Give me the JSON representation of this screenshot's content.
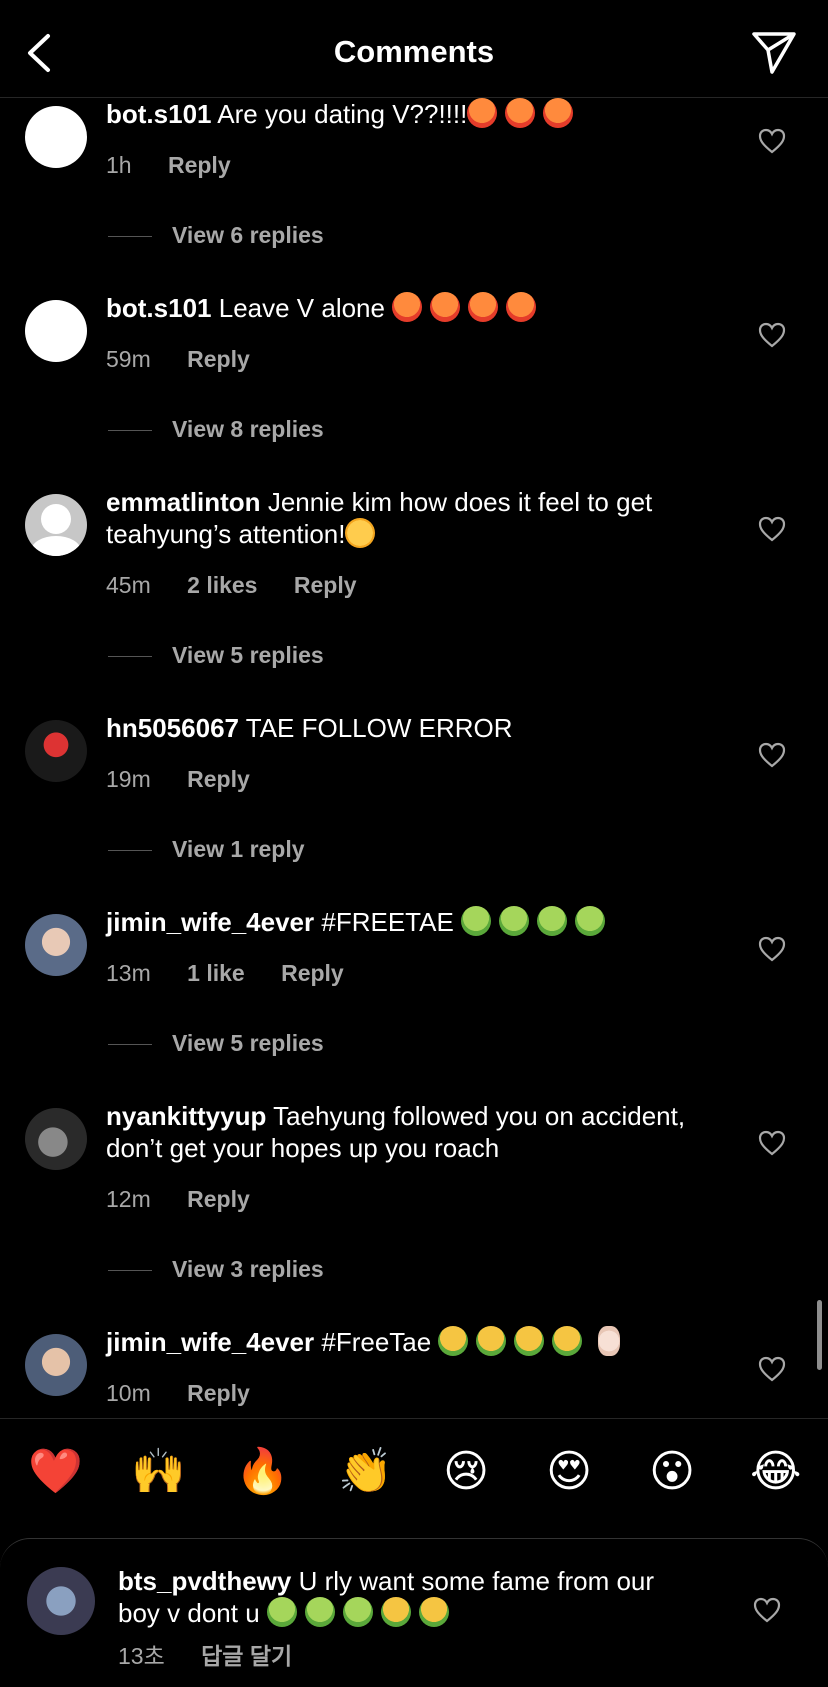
{
  "header": {
    "title": "Comments"
  },
  "comments": [
    {
      "username": "bot.s101",
      "text": "Are you dating V??!!!!",
      "time": "1h",
      "likes": "",
      "reply": "Reply",
      "view_replies": "View 6 replies"
    },
    {
      "username": "bot.s101",
      "text": "Leave V alone",
      "time": "59m",
      "likes": "",
      "reply": "Reply",
      "view_replies": "View 8 replies"
    },
    {
      "username": "emmatlinton",
      "text": "Jennie kim how does it feel to get teahyung’s attention!",
      "time": "45m",
      "likes": "2 likes",
      "reply": "Reply",
      "view_replies": "View 5 replies"
    },
    {
      "username": "hn5056067",
      "text": "TAE FOLLOW ERROR",
      "time": "19m",
      "likes": "",
      "reply": "Reply",
      "view_replies": "View 1 reply"
    },
    {
      "username": "jimin_wife_4ever",
      "text": "#FREETAE",
      "time": "13m",
      "likes": "1 like",
      "reply": "Reply",
      "view_replies": "View 5 replies"
    },
    {
      "username": "nyankittyyup",
      "text": "Taehyung followed you on accident, don’t get your hopes up you roach",
      "time": "12m",
      "likes": "",
      "reply": "Reply",
      "view_replies": "View 3 replies"
    },
    {
      "username": "jimin_wife_4ever",
      "text": "#FreeTae",
      "time": "10m",
      "likes": "",
      "reply": "Reply",
      "view_replies": ""
    }
  ],
  "reactions": [
    "❤️",
    "🙌",
    "🔥",
    "👏",
    "😢",
    "😍",
    "😮",
    "😂"
  ],
  "bottom_comment": {
    "username": "bts_pvdthewy",
    "text": "U rly want some fame from our boy v dont u",
    "time": "13초",
    "reply": "답글 달기"
  },
  "icons": {
    "back": "chevron-left-icon",
    "send": "paper-plane-icon",
    "like": "heart-outline-icon"
  },
  "colors": {
    "background": "#000000",
    "secondary_text": "#a8a8a8",
    "divider": "#262626"
  }
}
